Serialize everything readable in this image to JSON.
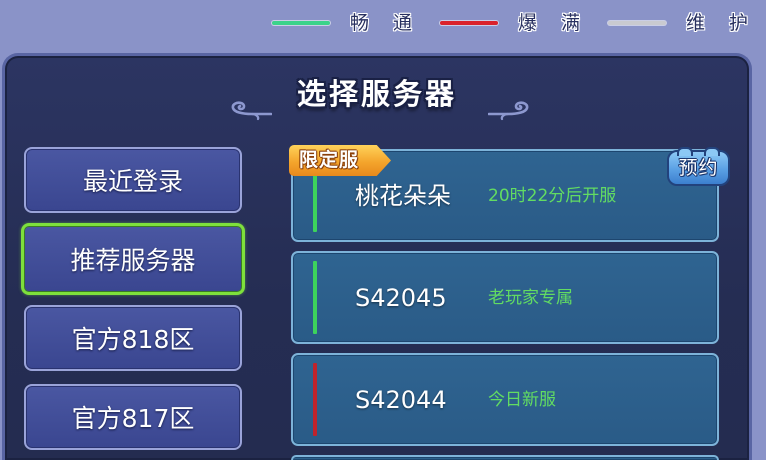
{
  "legend": [
    {
      "label": "畅通",
      "color": "#3bd38a"
    },
    {
      "label": "爆满",
      "color": "#da222b"
    },
    {
      "label": "维护",
      "color": "#c9cad0"
    }
  ],
  "title": "选择服务器",
  "categories": {
    "selected_index": 1,
    "items": [
      "最近登录",
      "推荐服务器",
      "官方818区",
      "官方817区"
    ]
  },
  "servers": [
    {
      "name": "桃花朵朵",
      "note": "20时22分后开服",
      "status_color": "#3dd35c",
      "badge": "限定服",
      "tag": "预约"
    },
    {
      "name": "S42045",
      "note": "老玩家专属",
      "status_color": "#3dd35c"
    },
    {
      "name": "S42044",
      "note": "今日新服",
      "status_color": "#c0232c"
    }
  ]
}
